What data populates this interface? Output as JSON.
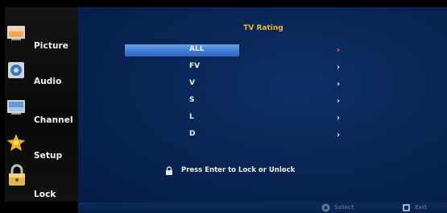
{
  "sidebar": {
    "items": [
      {
        "label": "Picture",
        "icon": "picture-icon"
      },
      {
        "label": "Audio",
        "icon": "audio-icon"
      },
      {
        "label": "Channel",
        "icon": "channel-icon"
      },
      {
        "label": "Setup",
        "icon": "setup-icon"
      },
      {
        "label": "Lock",
        "icon": "lock-icon",
        "active": true
      }
    ]
  },
  "main": {
    "title": "TV Rating",
    "rows": [
      {
        "label": "ALL",
        "selected": true
      },
      {
        "label": "FV"
      },
      {
        "label": "V"
      },
      {
        "label": "S"
      },
      {
        "label": "L"
      },
      {
        "label": "D"
      }
    ],
    "message": "Press Enter to Lock or Unlock"
  },
  "footer": {
    "select_label": "Select",
    "exit_label": "Exit"
  },
  "colors": {
    "title": "#f0b72a",
    "highlight": "#3e7ad4",
    "panel": "#082656",
    "selected_arrow": "#f08a2b"
  }
}
